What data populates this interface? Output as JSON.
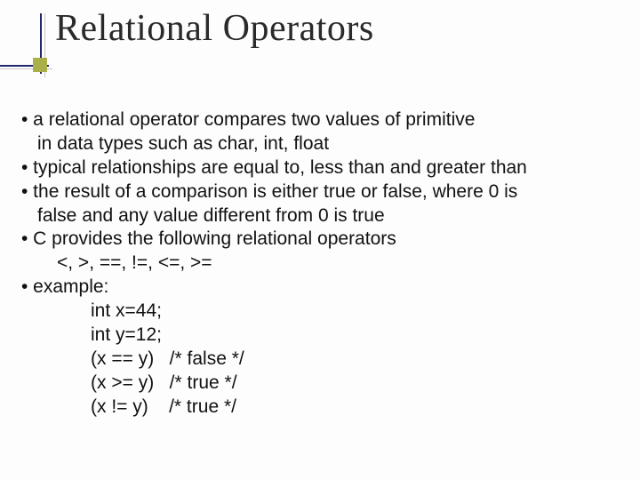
{
  "title": "Relational Operators",
  "bullets": {
    "b1a": "• a relational operator compares two values of primitive",
    "b1b": "in data types such as char, int, float",
    "b2": "• typical relationships are equal to, less than and greater than",
    "b3a": "• the result of a comparison is either true or false, where 0 is",
    "b3b": "false and any value different from 0 is true",
    "b4": "• C provides the following relational operators",
    "ops": "<, >, ==, !=, <=, >=",
    "b5": "• example:"
  },
  "code": {
    "l1": "int x=44;",
    "l2": "int y=12;",
    "l3": "(x == y)   /* false */",
    "l4": "(x >= y)   /* true */",
    "l5": "(x != y)    /* true */"
  }
}
